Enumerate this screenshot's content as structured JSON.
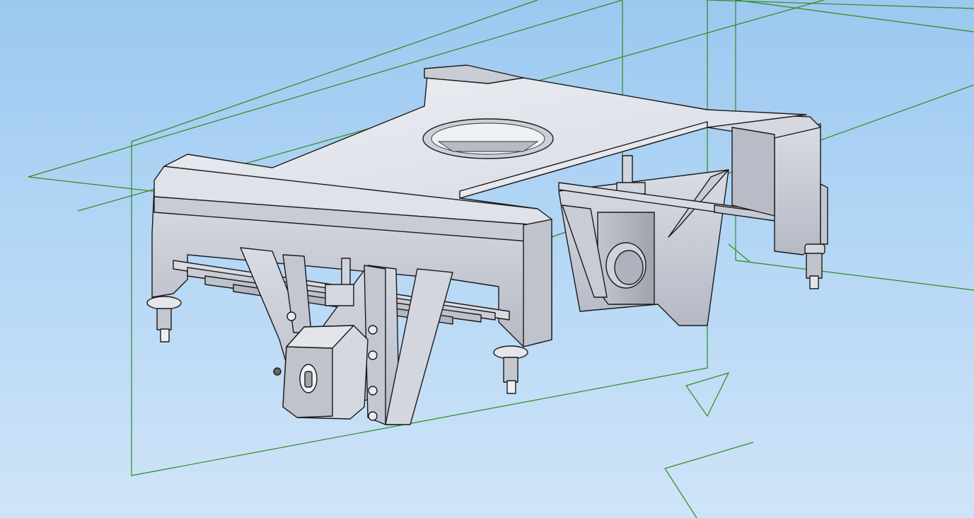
{
  "viewport": {
    "background_top": "#9cc8f0",
    "background_bottom": "#cfe4f8",
    "plane_color": "#2f8a1e",
    "part_color": "#e2e5ec",
    "part_shadow": "#b9bdc8",
    "edge_color": "#1a1a1a"
  },
  "model": {
    "type": "3d-cad-assembly",
    "components": [
      "frame-top-plate",
      "center-bore",
      "leaf-spring-left",
      "leaf-spring-right",
      "axle-box-front",
      "axle-box-rear",
      "coil-bolts"
    ]
  },
  "triad": {
    "icon": "plane-triad-icon"
  }
}
